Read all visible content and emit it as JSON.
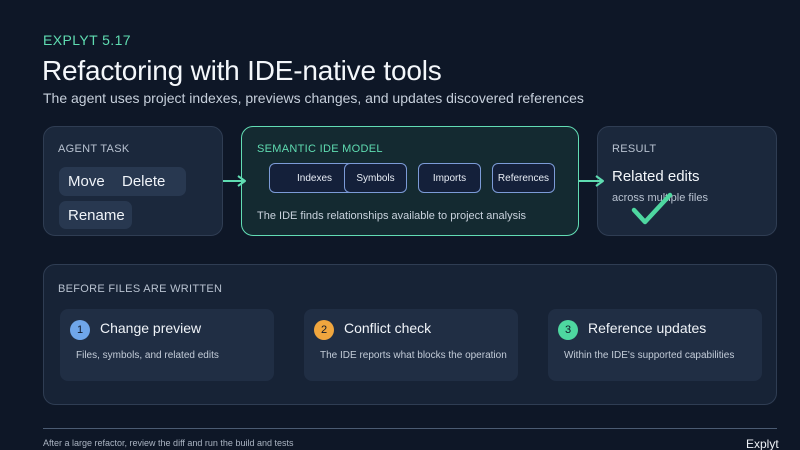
{
  "header": {
    "eyebrow": "EXPLYT 5.17",
    "title": "Refactoring with IDE-native tools",
    "subtitle": "The agent uses project indexes, previews changes, and updates discovered references"
  },
  "agent_task": {
    "label": "AGENT TASK",
    "actions": [
      "Move",
      "Delete",
      "Rename"
    ]
  },
  "semantic_model": {
    "label": "SEMANTIC IDE MODEL",
    "items": [
      "Indexes",
      "Symbols",
      "Imports",
      "References"
    ],
    "note": "The IDE finds relationships available to project analysis"
  },
  "result": {
    "label": "RESULT",
    "title": "Related edits",
    "subtitle": "across multiple files"
  },
  "before_files": {
    "label": "BEFORE FILES ARE WRITTEN",
    "steps": [
      {
        "number": "1",
        "title": "Change preview",
        "description": "Files, symbols, and related edits"
      },
      {
        "number": "2",
        "title": "Conflict check",
        "description": "The IDE reports what blocks the operation"
      },
      {
        "number": "3",
        "title": "Reference updates",
        "description": "Within the IDE's supported capabilities"
      }
    ]
  },
  "footer": {
    "note": "After a large refactor, review the diff and run the build and tests",
    "brand": "Explyt"
  },
  "colors": {
    "background": "#0e1727",
    "accent_green": "#5fdcb1",
    "pill_border": "#7c9bd7",
    "step1": "#6fa6ea",
    "step2": "#f0a63e",
    "step3": "#4ed7a0"
  },
  "icons": {
    "arrows": "arrow-right-icon",
    "result_mark": "checkmark-icon"
  }
}
